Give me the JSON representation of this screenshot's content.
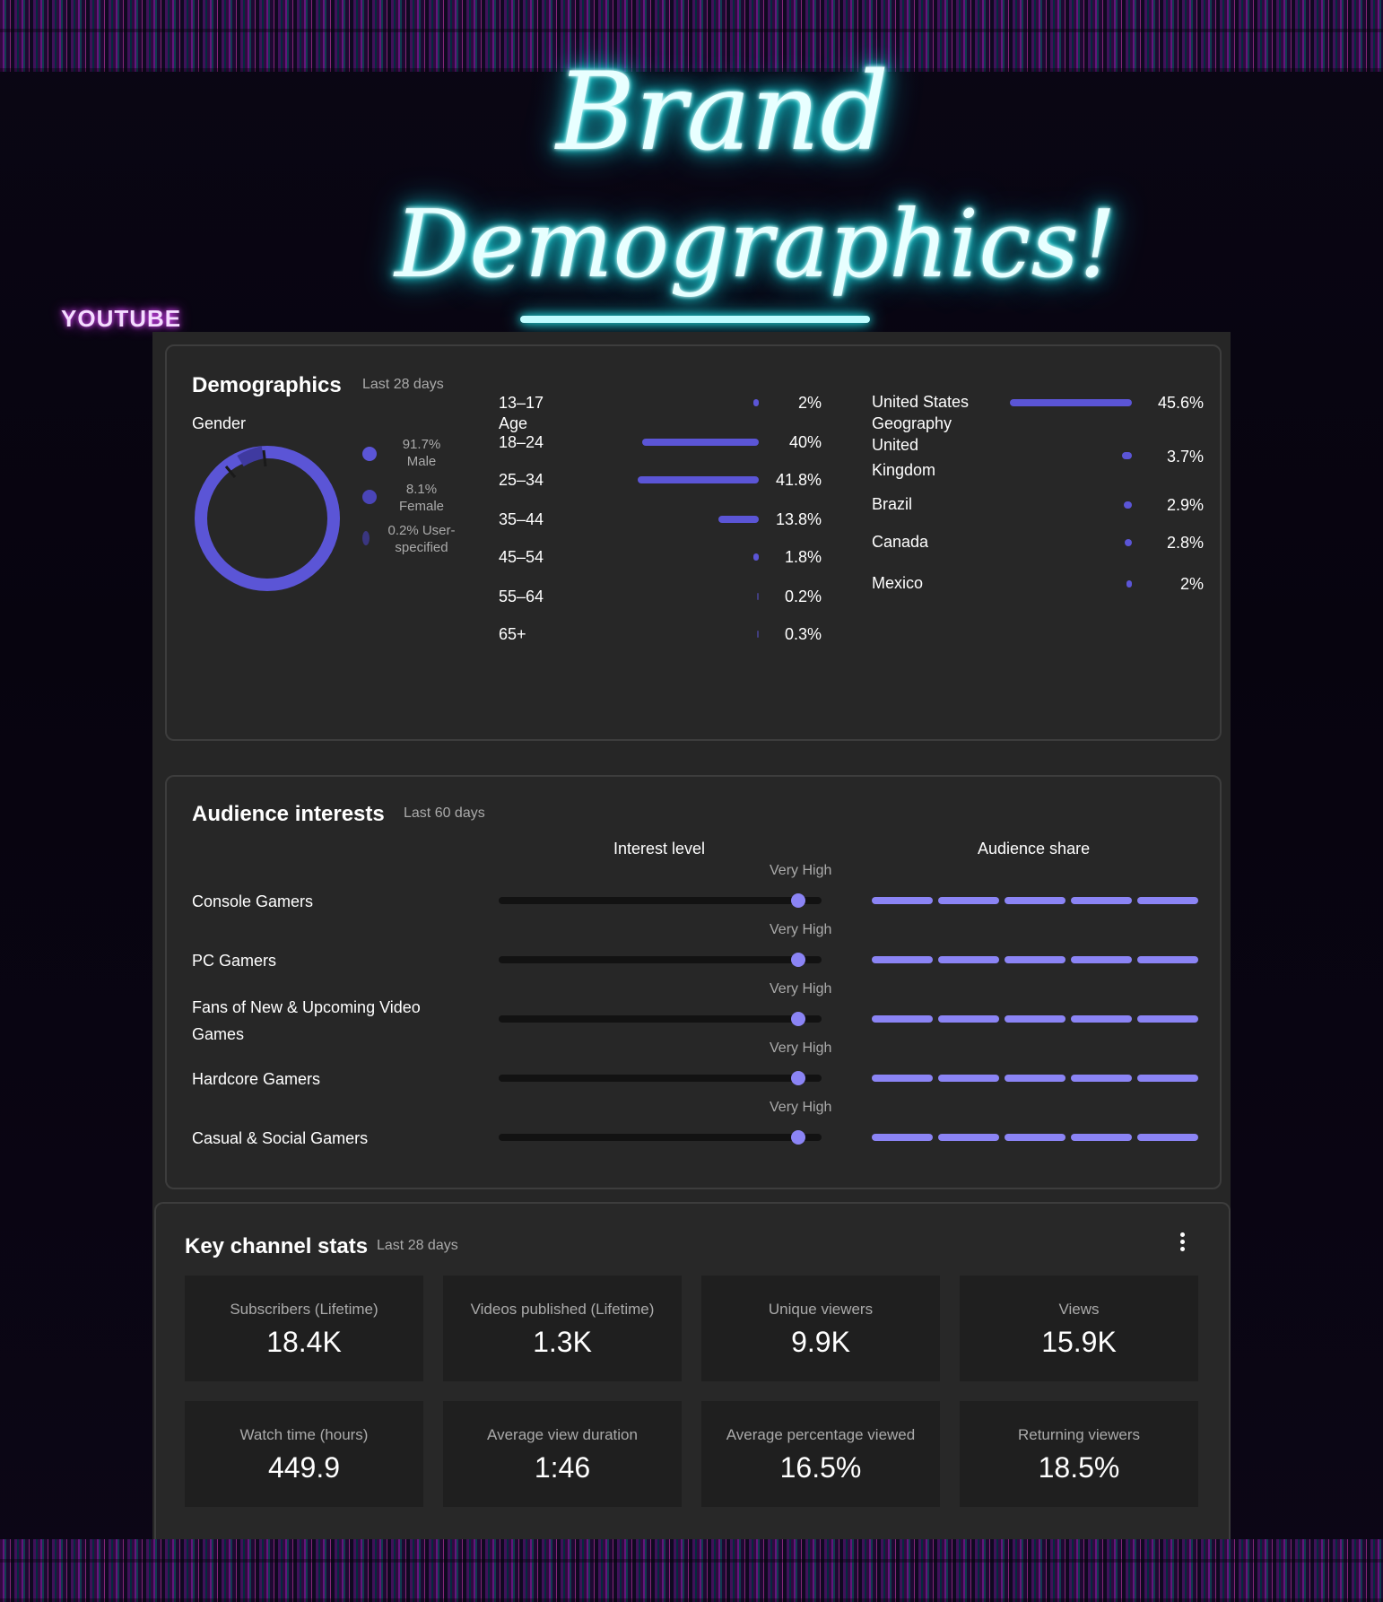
{
  "header": {
    "platform_label": "YOUTUBE",
    "neon_line1": "Brand",
    "neon_line2": "Demographics!"
  },
  "demographics": {
    "title": "Demographics",
    "period": "Last 28 days",
    "gender": {
      "label": "Gender",
      "items": [
        {
          "value": "91.7%",
          "name": "Male"
        },
        {
          "value": "8.1%",
          "name": "Female"
        },
        {
          "value": "0.2% User-",
          "name": "specified"
        }
      ],
      "shares": [
        91.7,
        8.1,
        0.2
      ]
    },
    "age": {
      "label": "Age",
      "rows": [
        {
          "label": "13–17",
          "value": "2%",
          "pct": 2
        },
        {
          "label": "18–24",
          "value": "40%",
          "pct": 40
        },
        {
          "label": "25–34",
          "value": "41.8%",
          "pct": 41.8
        },
        {
          "label": "35–44",
          "value": "13.8%",
          "pct": 13.8
        },
        {
          "label": "45–54",
          "value": "1.8%",
          "pct": 1.8
        },
        {
          "label": "55–64",
          "value": "0.2%",
          "pct": 0.2
        },
        {
          "label": "65+",
          "value": "0.3%",
          "pct": 0.3
        }
      ]
    },
    "geography": {
      "label": "Geography",
      "rows": [
        {
          "label": "United States",
          "value": "45.6%",
          "pct": 45.6
        },
        {
          "label": "United Kingdom",
          "value": "3.7%",
          "pct": 3.7
        },
        {
          "label": "Brazil",
          "value": "2.9%",
          "pct": 2.9
        },
        {
          "label": "Canada",
          "value": "2.8%",
          "pct": 2.8
        },
        {
          "label": "Mexico",
          "value": "2%",
          "pct": 2
        }
      ]
    }
  },
  "interests": {
    "title": "Audience interests",
    "period": "Last 60 days",
    "col_interest": "Interest level",
    "col_share": "Audience share",
    "rows": [
      {
        "label": "Console Gamers",
        "level": "Very High",
        "level_fraction": 0.95,
        "share_segments": 5
      },
      {
        "label": "PC Gamers",
        "level": "Very High",
        "level_fraction": 0.95,
        "share_segments": 5
      },
      {
        "label": "Fans of New & Upcoming Video Games",
        "level": "Very High",
        "level_fraction": 0.95,
        "share_segments": 5
      },
      {
        "label": "Hardcore Gamers",
        "level": "Very High",
        "level_fraction": 0.95,
        "share_segments": 5
      },
      {
        "label": "Casual & Social Gamers",
        "level": "Very High",
        "level_fraction": 0.95,
        "share_segments": 5
      }
    ]
  },
  "stats": {
    "title": "Key channel stats",
    "period": "Last 28 days",
    "tiles": [
      {
        "label": "Subscribers (Lifetime)",
        "value": "18.4K"
      },
      {
        "label": "Videos published (Lifetime)",
        "value": "1.3K"
      },
      {
        "label": "Unique viewers",
        "value": "9.9K"
      },
      {
        "label": "Views",
        "value": "15.9K"
      },
      {
        "label": "Watch time (hours)",
        "value": "449.9"
      },
      {
        "label": "Average view duration",
        "value": "1:46"
      },
      {
        "label": "Average percentage viewed",
        "value": "16.5%"
      },
      {
        "label": "Returning viewers",
        "value": "18.5%"
      }
    ]
  },
  "colors": {
    "accent": "#5b55d6",
    "accent_light": "#8b84f5",
    "neon": "#25f0f0",
    "youtube_label": "#e04bff",
    "panel_bg": "#262626"
  }
}
